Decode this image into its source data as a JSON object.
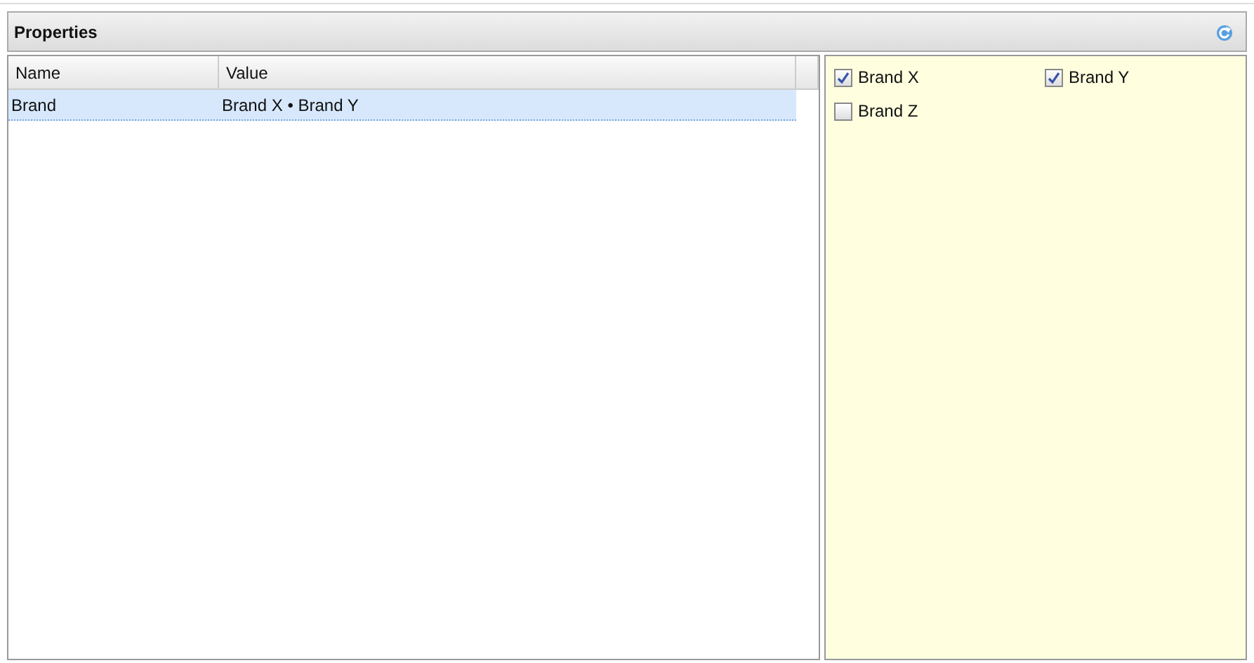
{
  "panel": {
    "title": "Properties"
  },
  "table": {
    "columns": [
      "Name",
      "Value"
    ],
    "rows": [
      {
        "cells": [
          "Brand",
          "Brand X • Brand Y"
        ],
        "selected": true
      }
    ]
  },
  "options": [
    {
      "label": "Brand X",
      "checked": true
    },
    {
      "label": "Brand Y",
      "checked": true
    },
    {
      "label": "Brand Z",
      "checked": false
    }
  ]
}
